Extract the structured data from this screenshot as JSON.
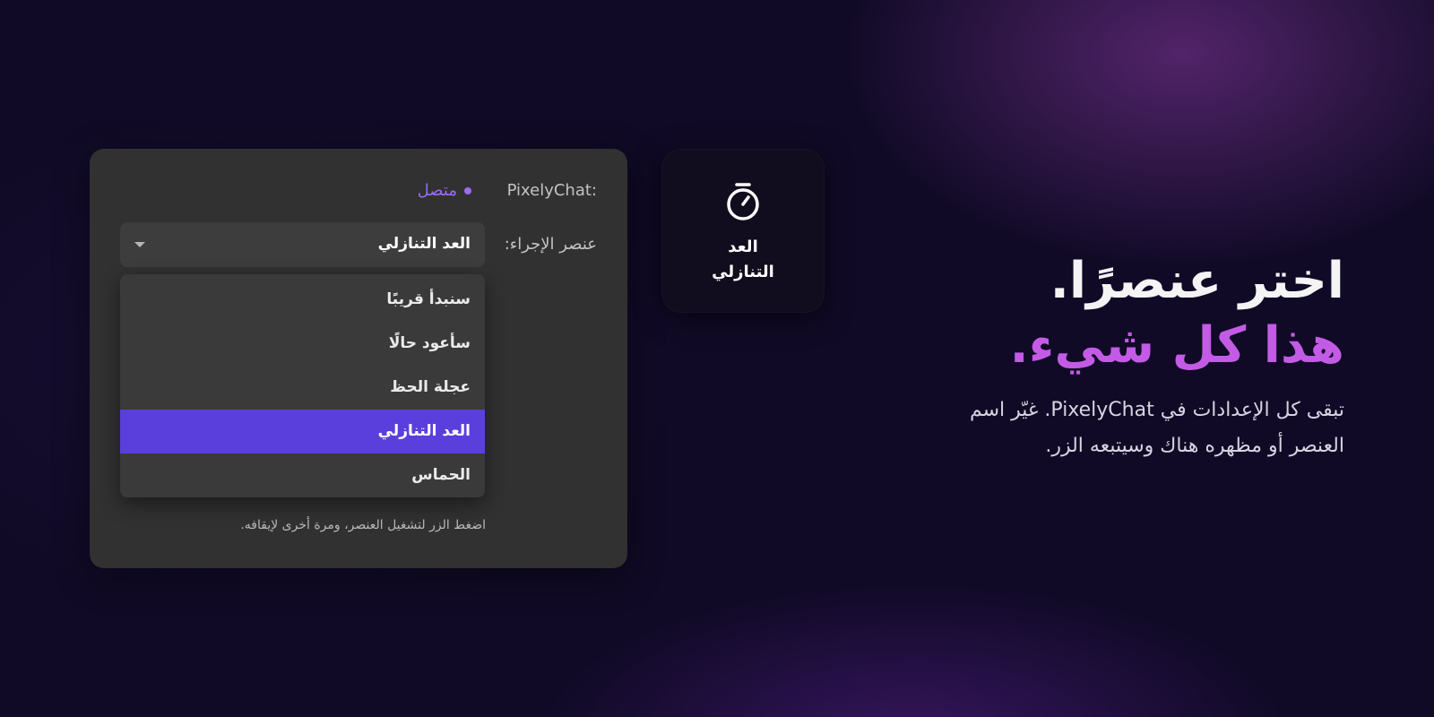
{
  "panel": {
    "app_label": "PixelyChat:",
    "status_text": "متصل",
    "action_label": "عنصر الإجراء:",
    "select_value": "العد التنازلي",
    "menu_items": [
      {
        "label": "سنبدأ قريبًا",
        "selected": false
      },
      {
        "label": "سأعود حالًا",
        "selected": false
      },
      {
        "label": "عجلة الحظ",
        "selected": false
      },
      {
        "label": "العد التنازلي",
        "selected": true
      },
      {
        "label": "الحماس",
        "selected": false
      }
    ],
    "hint": "اضغط الزر لتشغيل العنصر، ومرة أخرى لإيقافه."
  },
  "tile": {
    "icon": "stopwatch-icon",
    "label_line1": "العد",
    "label_line2": "التنازلي"
  },
  "hero": {
    "headline": "اختر عنصرًا.",
    "subheadline": "هذا كل شيء.",
    "description": "تبقى كل الإعدادات في PixelyChat. غيّر اسم العنصر أو مظهره هناك وسيتبعه الزر."
  },
  "colors": {
    "background": "#100a26",
    "panel": "#313131",
    "accent": "#5b3fdc",
    "status": "#9b6cf2",
    "subheadline": "#c35be6"
  }
}
